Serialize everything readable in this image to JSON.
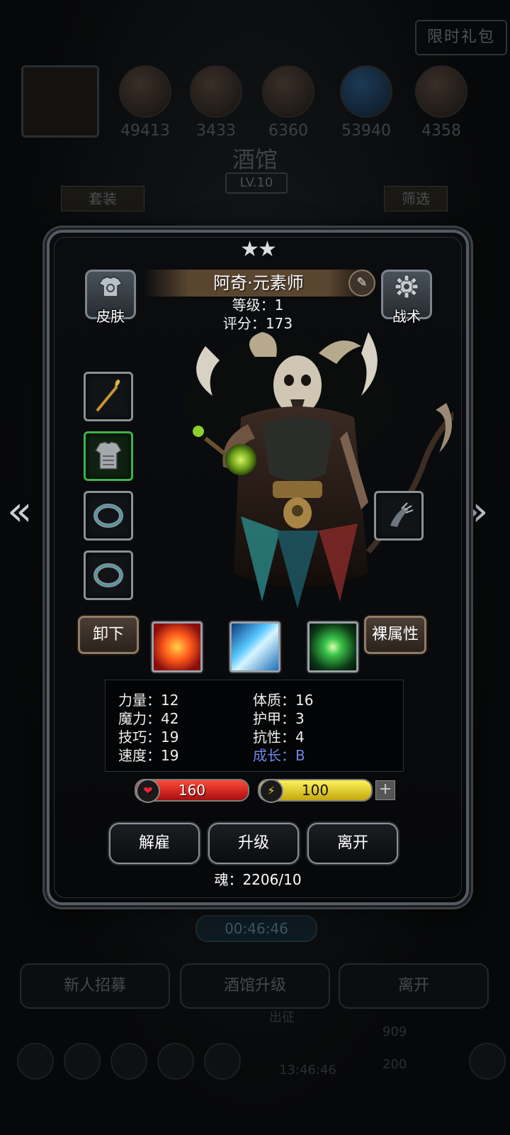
{
  "background": {
    "gift_label": "限时礼包",
    "resources": [
      "49413",
      "3433",
      "6360",
      "53940",
      "4358"
    ],
    "title": "酒馆",
    "level": "LV.10",
    "tab_left": "套装",
    "tab_right": "筛选",
    "timer": "00:46:46",
    "buttons": [
      "新人招募",
      "酒馆升级",
      "离开"
    ],
    "bottom_label": "出征",
    "bottom_timer": "13:46:46",
    "bottom_values": [
      "909",
      "200"
    ]
  },
  "hero": {
    "stars": "★★",
    "name": "阿奇·元素师",
    "level_text": "等级：1",
    "score_text": "评分：173",
    "skin_label": "皮肤",
    "tactics_label": "战术",
    "unequip_label": "卸下",
    "base_attr_label": "裸属性",
    "stats_left": [
      "力量：12",
      "魔力：42",
      "技巧：19",
      "速度：19"
    ],
    "stats_right": [
      "体质：16",
      "护甲：3",
      "抗性：4"
    ],
    "growth": "成长：B",
    "hp": "160",
    "energy": "100",
    "hp_fraction": 1.0,
    "energy_fraction": 1.0,
    "actions": {
      "dismiss": "解雇",
      "upgrade": "升级",
      "leave": "离开"
    },
    "soul": "魂：2206/10"
  },
  "colors": {
    "hp": "#c41d1d",
    "energy": "#d8c21a",
    "growth": "#6f86e6",
    "equip_highlight": "#3eb348"
  }
}
